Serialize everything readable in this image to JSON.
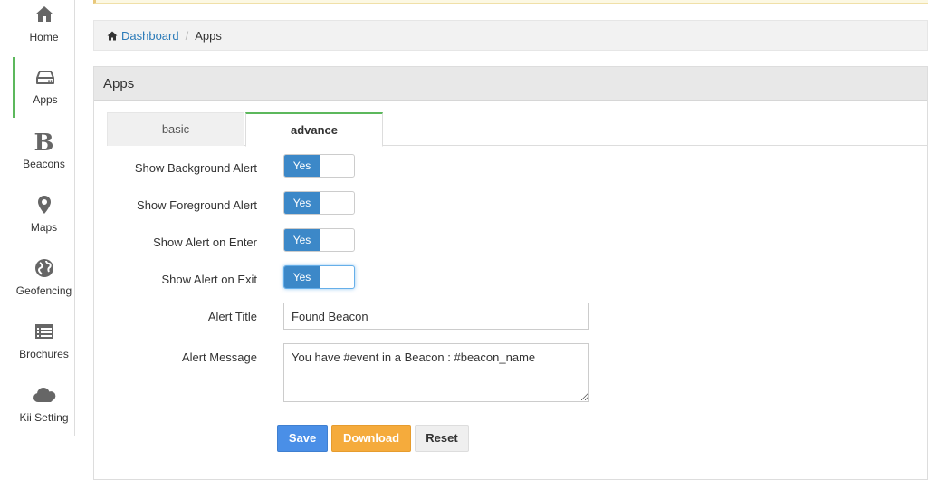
{
  "sidebar": {
    "items": [
      {
        "label": "Home",
        "icon": "home-icon"
      },
      {
        "label": "Apps",
        "icon": "hard-drive-icon",
        "active": true
      },
      {
        "label": "Beacons",
        "icon": "beacon-b-icon"
      },
      {
        "label": "Maps",
        "icon": "map-marker-icon"
      },
      {
        "label": "Geofencing",
        "icon": "globe-icon"
      },
      {
        "label": "Brochures",
        "icon": "list-icon"
      },
      {
        "label": "Kii Setting",
        "icon": "cloud-icon"
      }
    ]
  },
  "breadcrumb": {
    "home": "Dashboard",
    "current": "Apps"
  },
  "panel": {
    "title": "Apps"
  },
  "tabs": [
    {
      "label": "basic",
      "active": false
    },
    {
      "label": "advance",
      "active": true
    }
  ],
  "form": {
    "show_background_alert": {
      "label": "Show Background Alert",
      "value": "Yes"
    },
    "show_foreground_alert": {
      "label": "Show Foreground Alert",
      "value": "Yes"
    },
    "show_alert_on_enter": {
      "label": "Show Alert on Enter",
      "value": "Yes"
    },
    "show_alert_on_exit": {
      "label": "Show Alert on Exit",
      "value": "Yes"
    },
    "alert_title": {
      "label": "Alert Title",
      "value": "Found Beacon"
    },
    "alert_message": {
      "label": "Alert Message",
      "value": "You have #event in a Beacon : #beacon_name"
    }
  },
  "buttons": {
    "save": "Save",
    "download": "Download",
    "reset": "Reset"
  },
  "colors": {
    "accent_green": "#5cb85c",
    "toggle_blue": "#3c88c8",
    "save_blue": "#4a8fe7",
    "download_orange": "#f5ab3c",
    "link_blue": "#2a7ab8"
  }
}
